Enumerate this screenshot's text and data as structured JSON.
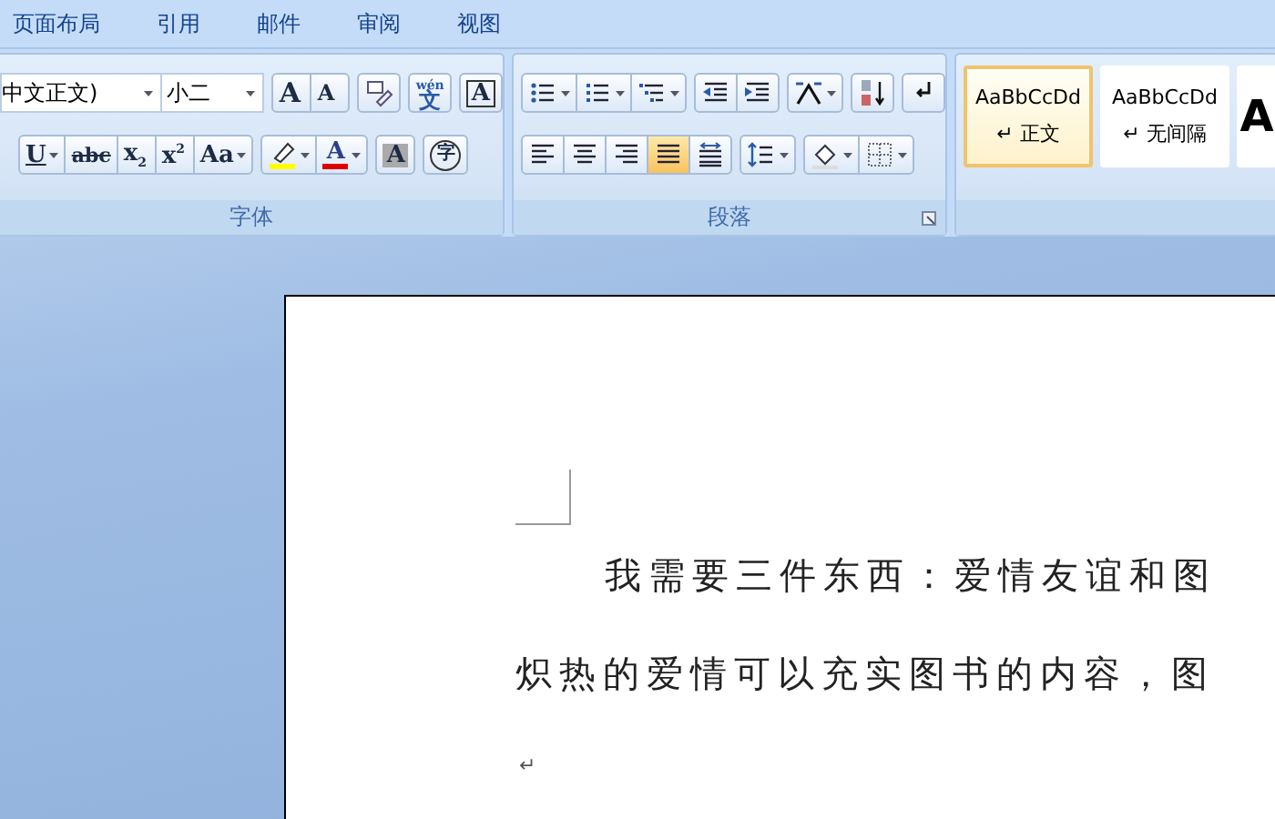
{
  "menu_tabs": [
    {
      "label": "页面布局",
      "selected": false
    },
    {
      "label": "引用",
      "selected": false
    },
    {
      "label": "邮件",
      "selected": false
    },
    {
      "label": "审阅",
      "selected": false
    },
    {
      "label": "视图",
      "selected": false
    }
  ],
  "font_group": {
    "label": "字体",
    "font_name": "中文正文)",
    "font_size": "小二",
    "row1": [
      [
        {
          "kind": "grow",
          "label": "A",
          "selected": false
        },
        {
          "kind": "shrink",
          "label": "A",
          "selected": false
        }
      ],
      [
        {
          "kind": "eraser",
          "selected": false
        }
      ],
      [
        {
          "kind": "phonetic",
          "label": "文",
          "ruby": "wén",
          "selected": false
        }
      ],
      [
        {
          "kind": "boxed",
          "label": "A",
          "selected": false
        }
      ]
    ],
    "row2": [
      [
        {
          "kind": "underline",
          "label": "U",
          "dropdown": true,
          "selected": false
        },
        {
          "kind": "strike",
          "label": "abc",
          "selected": false
        },
        {
          "kind": "sub",
          "label": "x",
          "mark": "2",
          "selected": false
        },
        {
          "kind": "sup",
          "label": "x",
          "mark": "2",
          "selected": false
        },
        {
          "kind": "case",
          "label": "Aa",
          "dropdown": true,
          "selected": false
        }
      ],
      [
        {
          "kind": "highlight",
          "color": "#ffff00",
          "dropdown": true,
          "selected": false
        },
        {
          "kind": "fontcolor",
          "label": "A",
          "color": "#e00000",
          "dropdown": true,
          "selected": false
        }
      ],
      [
        {
          "kind": "shaded",
          "label": "A",
          "selected": false
        }
      ],
      [
        {
          "kind": "enclosed",
          "label": "字",
          "selected": false
        }
      ]
    ]
  },
  "paragraph_group": {
    "label": "段落",
    "row1": [
      [
        {
          "kind": "bullets",
          "dropdown": true,
          "selected": false
        },
        {
          "kind": "numbering",
          "dropdown": true,
          "selected": false
        },
        {
          "kind": "outline",
          "dropdown": true,
          "selected": false
        }
      ],
      [
        {
          "kind": "outdent",
          "selected": false
        },
        {
          "kind": "indent",
          "selected": false
        }
      ],
      [
        {
          "kind": "layout",
          "dropdown": true,
          "selected": false
        }
      ],
      [
        {
          "kind": "sort",
          "selected": false
        }
      ],
      [
        {
          "kind": "marks",
          "selected": false
        }
      ]
    ],
    "row2": [
      [
        {
          "kind": "alignleft",
          "selected": false
        },
        {
          "kind": "center",
          "selected": false
        },
        {
          "kind": "alignright",
          "selected": false
        },
        {
          "kind": "justify",
          "selected": true
        },
        {
          "kind": "distribute",
          "selected": false
        }
      ],
      [
        {
          "kind": "spacing",
          "dropdown": true,
          "selected": false
        }
      ],
      [
        {
          "kind": "shading",
          "dropdown": true,
          "selected": false
        },
        {
          "kind": "borders",
          "dropdown": true,
          "selected": false
        }
      ]
    ]
  },
  "styles_gallery": [
    {
      "sample": "AaBbCcDd",
      "name": "↵ 正文",
      "selected": true
    },
    {
      "sample": "AaBbCcDd",
      "name": "↵ 无间隔",
      "selected": false
    },
    {
      "sample": "A",
      "selected": false
    }
  ],
  "document": {
    "lines": [
      "我需要三件东西：爱情友谊和图",
      "炽热的爱情可以充实图书的内容，图"
    ],
    "paragraph_mark": "↵"
  }
}
